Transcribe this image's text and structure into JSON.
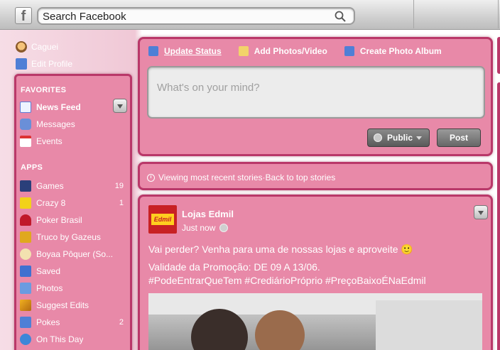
{
  "search": {
    "placeholder": "Search Facebook"
  },
  "profile": {
    "name": "Caguei",
    "edit_profile": "Edit Profile"
  },
  "favorites": {
    "title": "FAVORITES",
    "items": [
      {
        "label": "News Feed",
        "icon": "news-feed-icon",
        "count": ""
      },
      {
        "label": "Messages",
        "icon": "messages-icon",
        "count": ""
      },
      {
        "label": "Events",
        "icon": "events-icon",
        "count": ""
      }
    ]
  },
  "apps": {
    "title": "APPS",
    "items": [
      {
        "label": "Games",
        "icon": "games-icon",
        "count": "19"
      },
      {
        "label": "Crazy 8",
        "icon": "crazy8-icon",
        "count": "1"
      },
      {
        "label": "Poker Brasil",
        "icon": "poker-icon",
        "count": ""
      },
      {
        "label": "Truco by Gazeus",
        "icon": "truco-icon",
        "count": ""
      },
      {
        "label": "Boyaa Pôquer (So...",
        "icon": "boyaa-icon",
        "count": ""
      },
      {
        "label": "Saved",
        "icon": "saved-icon",
        "count": ""
      },
      {
        "label": "Photos",
        "icon": "photos-icon",
        "count": ""
      },
      {
        "label": "Suggest Edits",
        "icon": "suggest-edits-icon",
        "count": ""
      },
      {
        "label": "Pokes",
        "icon": "pokes-icon",
        "count": "2"
      },
      {
        "label": "On This Day",
        "icon": "on-this-day-icon",
        "count": ""
      }
    ]
  },
  "composer": {
    "tabs": [
      {
        "label": "Update Status",
        "icon": "pencil-icon"
      },
      {
        "label": "Add Photos/Video",
        "icon": "photo-icon"
      },
      {
        "label": "Create Photo Album",
        "icon": "album-icon"
      }
    ],
    "placeholder": "What's on your mind?",
    "privacy_label": "Public",
    "post_label": "Post"
  },
  "feed_notice": {
    "viewing": "Viewing most recent stories",
    "separator": " · ",
    "back_link": "Back to top stories"
  },
  "story": {
    "page_name": "Lojas Edmil",
    "avatar_text": "Edmil",
    "time": "Just now",
    "line1": "Vai perder? Venha para uma de nossas lojas e aproveite 🙂",
    "line2": "Validade da Promoção: DE 09 A 13/06.",
    "line3": "#PodeEntrarQueTem #CrediárioPróprio #PreçoBaixoÉNaEdmil"
  },
  "colors": {
    "panel_bg": "#e889a8",
    "panel_border": "#b93869",
    "text": "#ffffff"
  }
}
